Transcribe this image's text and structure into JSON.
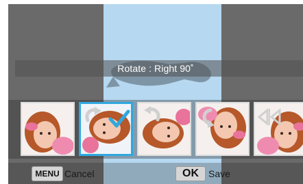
{
  "rotate": {
    "label": "Rotate : Right 90˚"
  },
  "thumbnails": [
    {
      "name": "original",
      "overlay": ""
    },
    {
      "name": "rotate-right",
      "overlay": "rotate-right-icon",
      "selected": true
    },
    {
      "name": "rotate-left",
      "overlay": "rotate-left-icon"
    },
    {
      "name": "rotate-180",
      "overlay": "rotate-180-icon"
    },
    {
      "name": "flip-horizontal",
      "overlay": "flip-horizontal-icon"
    }
  ],
  "footer": {
    "menu_key": "MENU",
    "menu_action": "Cancel",
    "ok_key": "OK",
    "ok_action": "Save"
  },
  "colors": {
    "accent": "#2fa8e0",
    "preview": "#b6d8f0",
    "screen": "#6a6a6a"
  }
}
